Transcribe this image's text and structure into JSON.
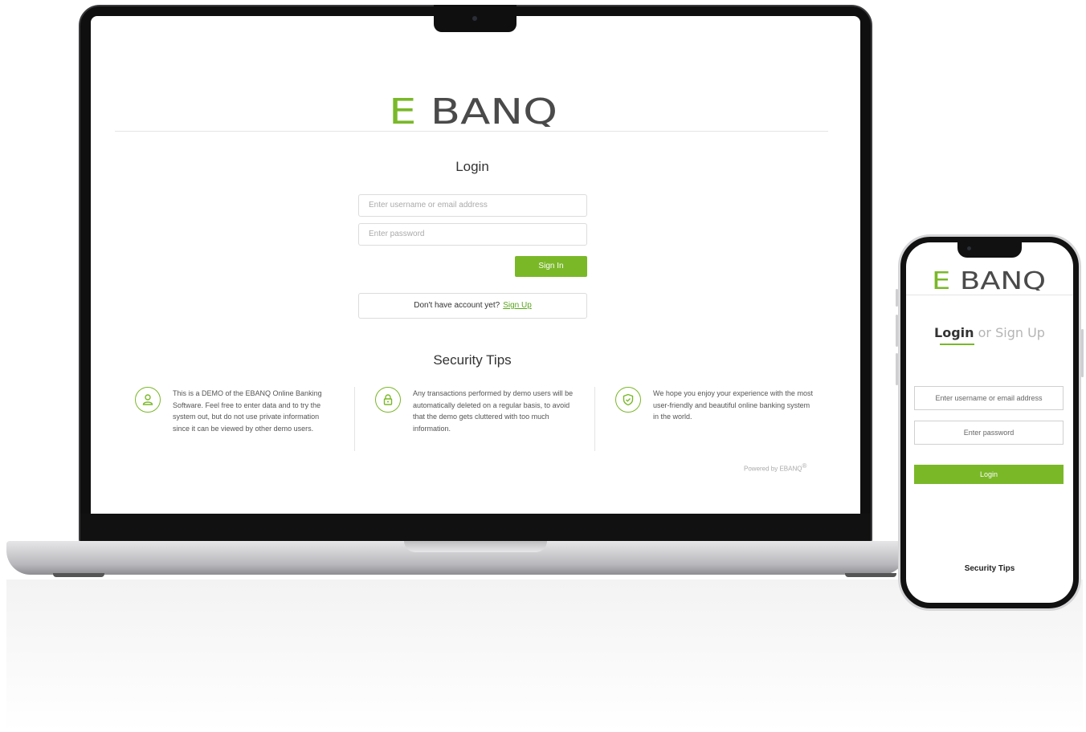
{
  "brand": {
    "logo_text": "EBANQ",
    "accent_color": "#7ab828",
    "logo_gray": "#4a4a4a"
  },
  "desktop": {
    "title": "Login",
    "username_placeholder": "Enter username or email address",
    "password_placeholder": "Enter password",
    "signin_label": "Sign In",
    "no_account_text": "Don't have account yet?",
    "signup_link": "Sign Up",
    "tips_title": "Security Tips",
    "tips": [
      {
        "icon": "user-icon",
        "text": "This is a DEMO of the EBANQ Online Banking Software. Feel free to enter data and to try the system out, but do not use private information since it can be viewed by other demo users."
      },
      {
        "icon": "lock-icon",
        "text": "Any transactions performed by demo users will be automatically deleted on a regular basis, to avoid that the demo gets cluttered with too much information."
      },
      {
        "icon": "shield-check-icon",
        "text": "We hope you enjoy your experience with the most user-friendly and beautiful online banking system in the world."
      }
    ],
    "powered_by": "Powered by EBANQ",
    "registered_mark": "®"
  },
  "mobile": {
    "tab_login": "Login",
    "tab_or_signup": "or Sign Up",
    "username_placeholder": "Enter username or email address",
    "password_placeholder": "Enter password",
    "login_label": "Login",
    "tips_title": "Security Tips"
  }
}
